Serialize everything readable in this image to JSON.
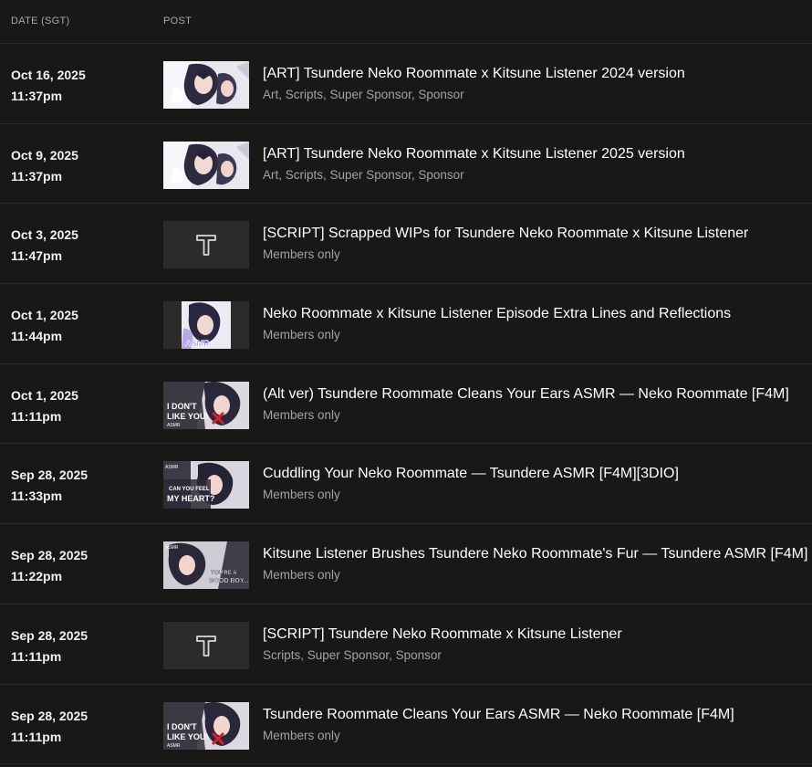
{
  "headers": {
    "date": "DATE (SGT)",
    "post": "POST"
  },
  "rows": [
    {
      "date": "Oct 16, 2025",
      "time": "11:37pm",
      "title": "[ART] Tsundere Neko Roommate x Kitsune Listener 2024 version",
      "tags": "Art, Scripts, Super Sponsor, Sponsor",
      "thumb": "art-image"
    },
    {
      "date": "Oct 9, 2025",
      "time": "11:37pm",
      "title": "[ART] Tsundere Neko Roommate x Kitsune Listener 2025 version",
      "tags": "Art, Scripts, Super Sponsor, Sponsor",
      "thumb": "art-image"
    },
    {
      "date": "Oct 3, 2025",
      "time": "11:47pm",
      "title": "[SCRIPT] Scrapped WIPs for Tsundere Neko Roommate x Kitsune Listener",
      "tags": "Members only",
      "thumb": "text-post-icon"
    },
    {
      "date": "Oct 1, 2025",
      "time": "11:44pm",
      "title": "Neko Roommate x Kitsune Listener Episode Extra Lines and Reflections",
      "tags": "Members only",
      "thumb": "asmr-image"
    },
    {
      "date": "Oct 1, 2025",
      "time": "11:11pm",
      "title": "(Alt ver) Tsundere Roommate Cleans Your Ears ASMR — Neko Roommate [F4M]",
      "tags": "Members only",
      "thumb": "dont-like-you-image"
    },
    {
      "date": "Sep 28, 2025",
      "time": "11:33pm",
      "title": "Cuddling Your Neko Roommate — Tsundere ASMR [F4M][3DIO]",
      "tags": "Members only",
      "thumb": "feel-my-heart-image"
    },
    {
      "date": "Sep 28, 2025",
      "time": "11:22pm",
      "title": "Kitsune Listener Brushes Tsundere Neko Roommate's Fur — Tsundere ASMR [F4M]",
      "tags": "Members only",
      "thumb": "good-boy-image"
    },
    {
      "date": "Sep 28, 2025",
      "time": "11:11pm",
      "title": "[SCRIPT] Tsundere Neko Roommate x Kitsune Listener",
      "tags": "Scripts, Super Sponsor, Sponsor",
      "thumb": "text-post-icon"
    },
    {
      "date": "Sep 28, 2025",
      "time": "11:11pm",
      "title": "Tsundere Roommate Cleans Your Ears ASMR — Neko Roommate [F4M]",
      "tags": "Members only",
      "thumb": "dont-like-you-image"
    }
  ],
  "thumb_text": {
    "asmr": "ASMR",
    "dont_like": "I DON'T",
    "dont_like2": "LIKE YOU!",
    "asmr_small": "ASMR",
    "feel1": "CAN YOU FEEL",
    "feel2": "MY HEART?",
    "good1": "YOU'RE A",
    "good2": "GOOD BOY..."
  },
  "colors": {
    "background": "#181816",
    "divider": "#2c2c29",
    "muted": "#a3a39e",
    "accent_red": "#d8202a"
  }
}
